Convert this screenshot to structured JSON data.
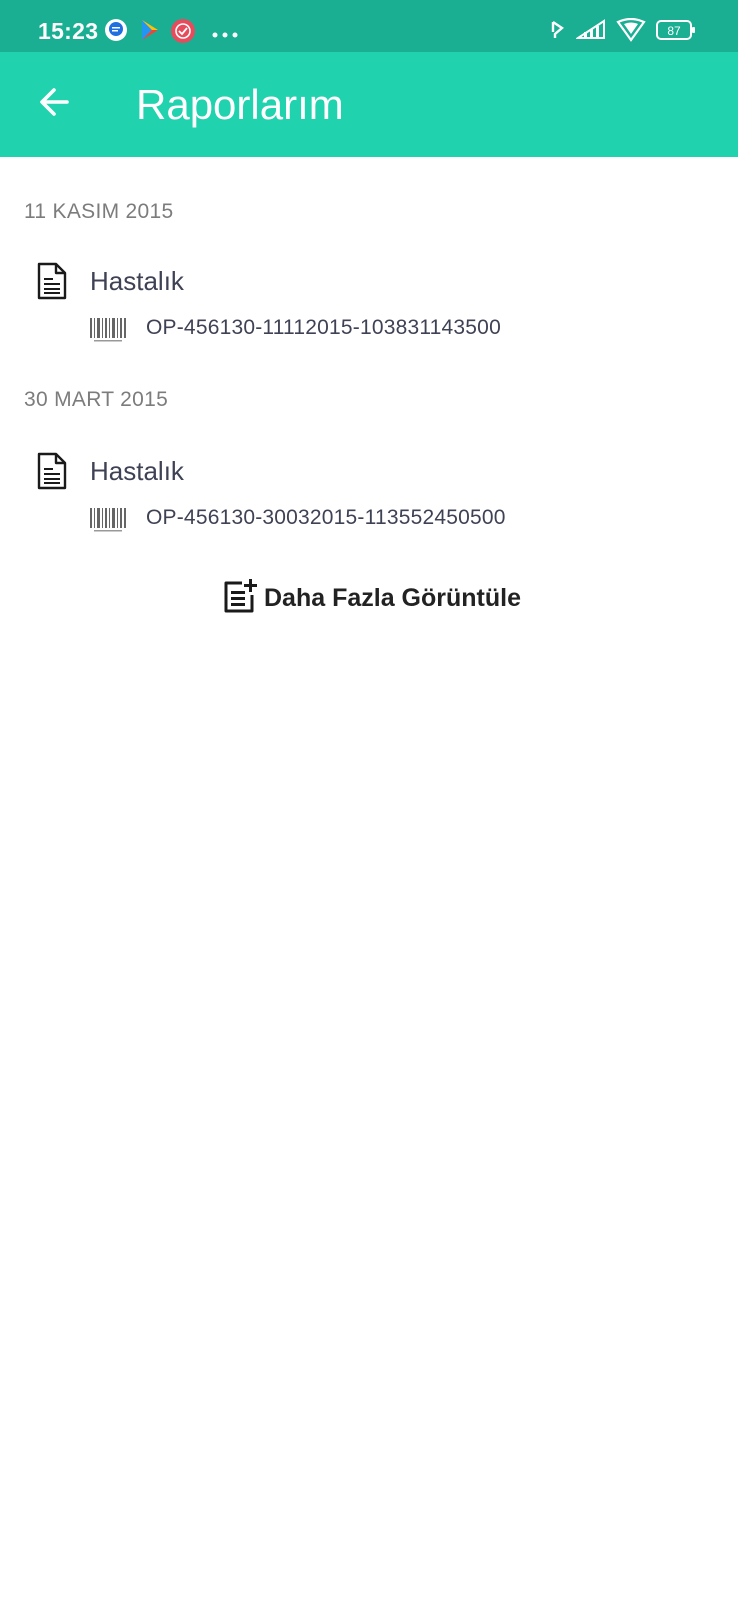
{
  "status_bar": {
    "time": "15:23",
    "battery": "87",
    "icons": [
      "messages-icon",
      "play-store-icon",
      "app-badge-icon",
      "more-dots-icon",
      "bluetooth-icon",
      "signal-icon",
      "wifi-icon",
      "battery-icon"
    ]
  },
  "header": {
    "title": "Raporlarım",
    "back_icon": "arrow-left-icon"
  },
  "reports": [
    {
      "date": "11 KASIM 2015",
      "type": "Hastalık",
      "code": "OP-456130-11112015-103831143500"
    },
    {
      "date": "30 MART 2015",
      "type": "Hastalık",
      "code": "OP-456130-30032015-113552450500"
    }
  ],
  "more_button": {
    "label": "Daha Fazla Görüntüle",
    "icon": "post-add-icon"
  },
  "colors": {
    "status_bar": "#1aae93",
    "app_bar": "#20d2ae",
    "text_primary": "#3f4254",
    "text_secondary": "#7c7c7c"
  }
}
